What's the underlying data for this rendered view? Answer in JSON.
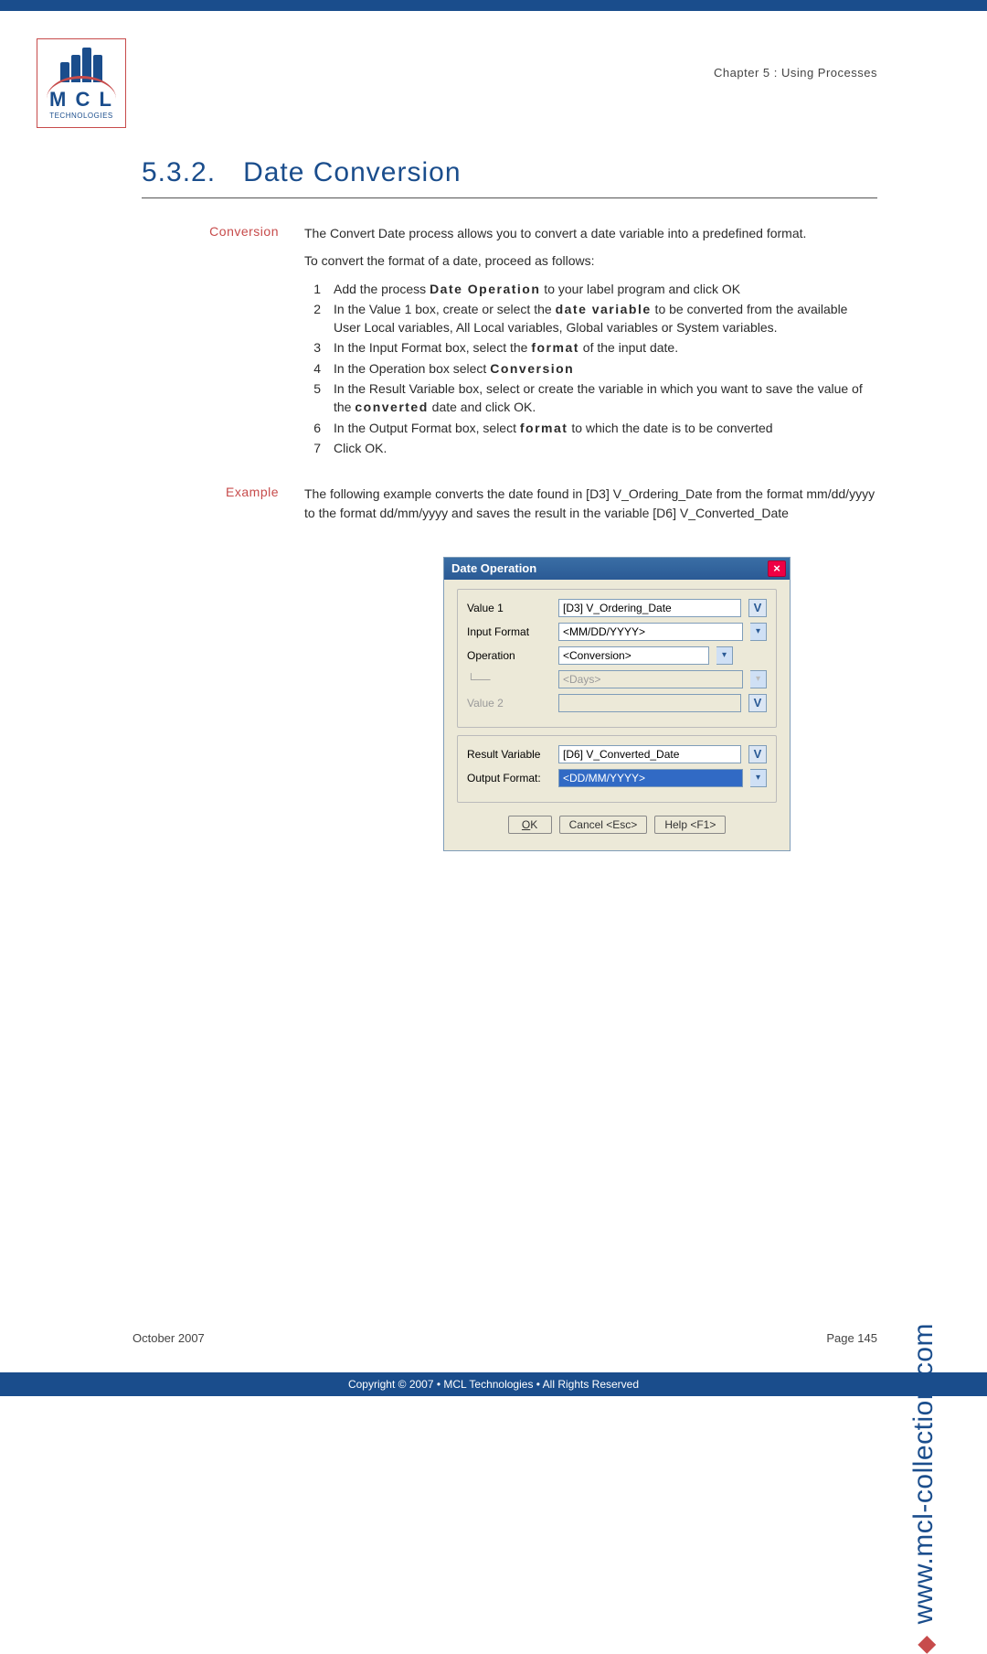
{
  "header": {
    "chapter": "Chapter 5 : Using Processes",
    "logo_letters": "M C L",
    "logo_sub": "TECHNOLOGIES"
  },
  "section": {
    "number": "5.3.2.",
    "title": "Date Conversion"
  },
  "conversion": {
    "label": "Conversion",
    "intro": "The Convert Date process allows you to convert a date variable into a predefined format.",
    "lead": "To convert the format of a date, proceed as follows:",
    "steps": [
      {
        "n": "1",
        "pre": "Add the process ",
        "b": "Date Operation",
        "post": " to your label program and click OK"
      },
      {
        "n": "2",
        "pre": "In the Value 1 box, create or select the ",
        "b": "date variable",
        "post": " to be converted from the available User Local variables, All Local variables, Global variables or System variables."
      },
      {
        "n": "3",
        "pre": "In the Input Format box, select the ",
        "b": "format",
        "post": " of the input date."
      },
      {
        "n": "4",
        "pre": "In the Operation box select ",
        "b": "Conversion",
        "post": ""
      },
      {
        "n": "5",
        "pre": "In the Result Variable box, select or create the variable in which you want to save the value of the ",
        "b": "converted",
        "post": " date and click OK."
      },
      {
        "n": "6",
        "pre": "In the Output Format box, select ",
        "b": "format",
        "post": " to which the date is to be converted"
      },
      {
        "n": "7",
        "pre": "Click OK.",
        "b": "",
        "post": ""
      }
    ]
  },
  "example": {
    "label": "Example",
    "text": "The following example converts the date found in [D3] V_Ordering_Date from the format mm/dd/yyyy to the format dd/mm/yyyy and saves the result in the variable [D6] V_Converted_Date"
  },
  "dialog": {
    "title": "Date Operation",
    "labels": {
      "value1": "Value 1",
      "input_format": "Input Format",
      "operation": "Operation",
      "days": "<Days>",
      "value2": "Value 2",
      "result_variable": "Result Variable",
      "output_format": "Output Format:"
    },
    "values": {
      "value1": "[D3] V_Ordering_Date",
      "input_format": "<MM/DD/YYYY>",
      "operation": "<Conversion>",
      "days": "<Days>",
      "value2": "",
      "result_variable": "[D6] V_Converted_Date",
      "output_format": "<DD/MM/YYYY>"
    },
    "buttons": {
      "ok": "OK",
      "cancel": "Cancel <Esc>",
      "help": "Help <F1>"
    }
  },
  "footer": {
    "date": "October 2007",
    "page": "Page 145",
    "url": "www.mcl-collection.com",
    "copyright": "Copyright © 2007 • MCL Technologies • All Rights Reserved"
  }
}
